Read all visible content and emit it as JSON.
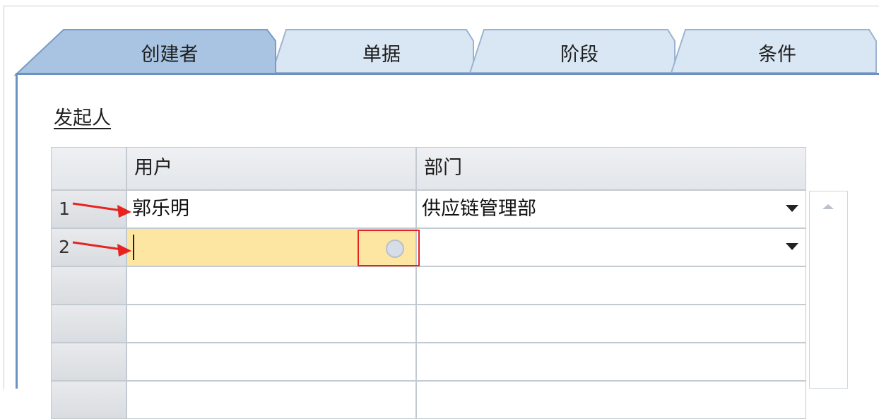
{
  "tabs": [
    {
      "label": "创建者",
      "active": true
    },
    {
      "label": "单据",
      "active": false
    },
    {
      "label": "阶段",
      "active": false
    },
    {
      "label": "条件",
      "active": false
    }
  ],
  "section": {
    "title": "发起人"
  },
  "table": {
    "columns": [
      "用户",
      "部门"
    ],
    "rows": [
      {
        "num": "1",
        "user": "郭乐明",
        "dept": "供应链管理部"
      },
      {
        "num": "2",
        "user": "",
        "dept": ""
      },
      {
        "num": "",
        "user": "",
        "dept": ""
      },
      {
        "num": "",
        "user": "",
        "dept": ""
      },
      {
        "num": "",
        "user": "",
        "dept": ""
      },
      {
        "num": "",
        "user": "",
        "dept": ""
      }
    ]
  },
  "colors": {
    "tab_active": "#a9c4e2",
    "tab_inactive": "#d7e4f1",
    "panel_border": "#6c93c0",
    "active_cell": "#fce6a2",
    "highlight_box": "#e8221e",
    "annotation_arrow": "#e8221e"
  },
  "icons": [
    "choose-from-list-icon",
    "dropdown-arrow-icon",
    "scroll-up-icon",
    "annotation-arrow-icon"
  ]
}
